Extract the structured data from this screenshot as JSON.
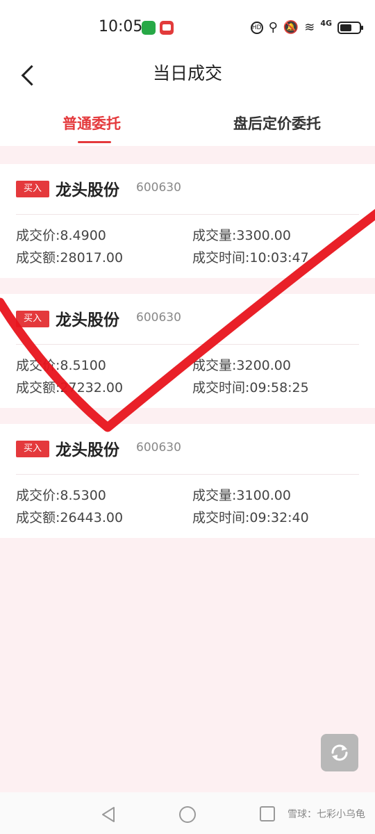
{
  "status_bar": {
    "time": "10:05",
    "network": "4G"
  },
  "header": {
    "title": "当日成交"
  },
  "tabs": [
    {
      "label": "普通委托",
      "active": true
    },
    {
      "label": "盘后定价委托",
      "active": false
    }
  ],
  "trades": [
    {
      "side": "买入",
      "name": "龙头股份",
      "code": "600630",
      "price": "成交价:8.4900",
      "volume": "成交量:3300.00",
      "amount": "成交额:28017.00",
      "time": "成交时间:10:03:47"
    },
    {
      "side": "买入",
      "name": "龙头股份",
      "code": "600630",
      "price": "成交价:8.5100",
      "volume": "成交量:3200.00",
      "amount": "成交额:27232.00",
      "time": "成交时间:09:58:25"
    },
    {
      "side": "买入",
      "name": "龙头股份",
      "code": "600630",
      "price": "成交价:8.5300",
      "volume": "成交量:3100.00",
      "amount": "成交额:26443.00",
      "time": "成交时间:09:32:40"
    }
  ],
  "watermark": "雪球：七彩小乌龟",
  "colors": {
    "accent": "#e4393c",
    "page_bg": "#fdf0f2",
    "annotation": "#e8141c"
  }
}
